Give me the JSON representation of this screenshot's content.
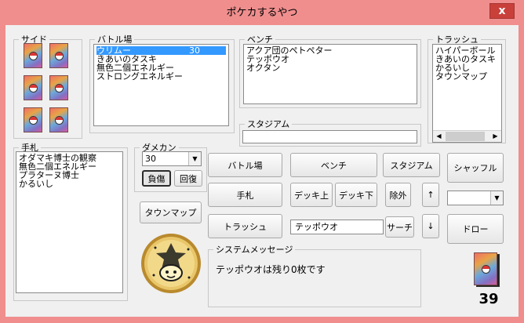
{
  "window": {
    "title": "ポケカするやつ",
    "close_label": "x"
  },
  "side": {
    "label": "サイド",
    "card_count": 6
  },
  "battle": {
    "label": "バトル場",
    "items": [
      {
        "name": "ウリムー",
        "value": "30",
        "selected": true
      },
      {
        "name": "きあいのタスキ",
        "value": ""
      },
      {
        "name": "無色二個エネルギー",
        "value": ""
      },
      {
        "name": "ストロングエネルギー",
        "value": ""
      }
    ]
  },
  "bench": {
    "label": "ベンチ",
    "items": [
      "アクア団のペトペター",
      "テッポウオ",
      "オクタン"
    ]
  },
  "trash": {
    "label": "トラッシュ",
    "items": [
      "ハイパーボール",
      "きあいのタスキ",
      "かるいし",
      "タウンマップ"
    ]
  },
  "stadium": {
    "label": "スタジアム",
    "value": ""
  },
  "hand": {
    "label": "手札",
    "items": [
      "オダマキ博士の観察",
      "無色二個エネルギー",
      "プラターヌ博士",
      "かるいし"
    ]
  },
  "damage": {
    "label": "ダメカン",
    "selected": "30",
    "injure_label": "負傷",
    "heal_label": "回復"
  },
  "buttons": {
    "townmap": "タウンマップ",
    "battle": "バトル場",
    "bench": "ベンチ",
    "stadium": "スタジアム",
    "shuffle": "シャッフル",
    "hand": "手札",
    "deck_top": "デッキ上",
    "deck_bottom": "デッキ下",
    "exclude": "除外",
    "up": "↑",
    "trash": "トラッシュ",
    "search": "サーチ",
    "down": "↓",
    "draw": "ドロー"
  },
  "search_input": {
    "value": "テッポウオ"
  },
  "right_combo": {
    "value": ""
  },
  "message": {
    "label": "システムメッセージ",
    "text": "テッポウオは残り0枚です"
  },
  "deck": {
    "count": "39"
  },
  "icons": {
    "coin": "jirachi-coin-icon",
    "deck": "card-back-icon"
  }
}
